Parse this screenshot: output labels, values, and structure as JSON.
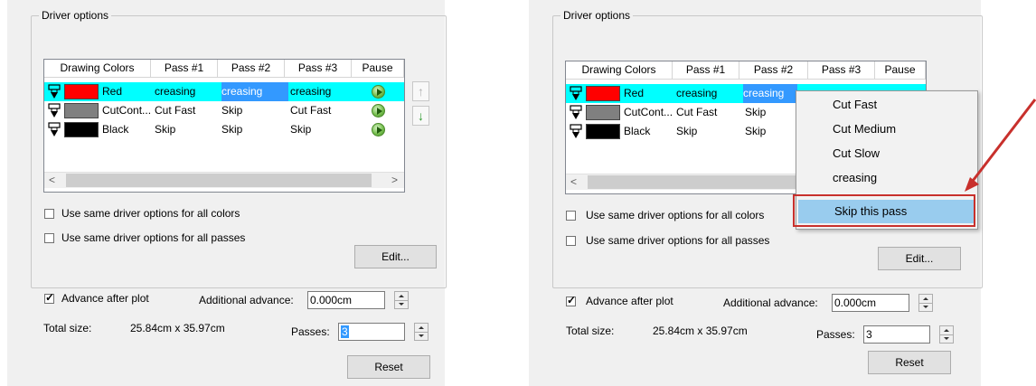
{
  "driver_options_title": "Driver options",
  "columns": [
    "Drawing Colors",
    "Pass #1",
    "Pass #2",
    "Pass #3",
    "Pause"
  ],
  "left": {
    "rows": [
      {
        "color_name": "Red",
        "swatch": "#ff0000",
        "pass1": "creasing",
        "pass2": "creasing",
        "pass3": "creasing"
      },
      {
        "color_name": "CutCont...",
        "swatch": "#808080",
        "pass1": "Cut Fast",
        "pass2": "Skip",
        "pass3": "Cut Fast"
      },
      {
        "color_name": "Black",
        "swatch": "#000000",
        "pass1": "Skip",
        "pass2": "Skip",
        "pass3": "Skip"
      }
    ],
    "move_up_icon": "arrow-up-icon",
    "move_down_icon": "arrow-down-icon"
  },
  "right": {
    "rows": [
      {
        "color_name": "Red",
        "swatch": "#ff0000",
        "pass1": "creasing",
        "pass2": "creasing"
      },
      {
        "color_name": "CutCont...",
        "swatch": "#808080",
        "pass1": "Cut Fast",
        "pass2": "Skip"
      },
      {
        "color_name": "Black",
        "swatch": "#000000",
        "pass1": "Skip",
        "pass2": "Skip"
      }
    ],
    "context_menu": [
      "Cut Fast",
      "Cut Medium",
      "Cut Slow",
      "creasing",
      "Skip this pass"
    ],
    "highlight_color": "#c8302c"
  },
  "checkbox_same_colors": "Use same driver options for all colors",
  "checkbox_same_passes": "Use same driver options for all passes",
  "edit_button": "Edit...",
  "advance_after_plot": "Advance after plot",
  "additional_advance_label": "Additional advance:",
  "additional_advance_value": "0.000cm",
  "total_size_label": "Total size:",
  "total_size_value": "25.84cm x 35.97cm",
  "passes_label": "Passes:",
  "passes_value": "3",
  "reset_button": "Reset",
  "scroll_left": "<",
  "scroll_right": ">",
  "accent_selection": "#3399ff",
  "row_highlight": "#00ffff",
  "icons": [
    "pen-icon",
    "play-icon",
    "arrow-up-icon",
    "arrow-down-icon",
    "pointer-arrow-icon"
  ]
}
